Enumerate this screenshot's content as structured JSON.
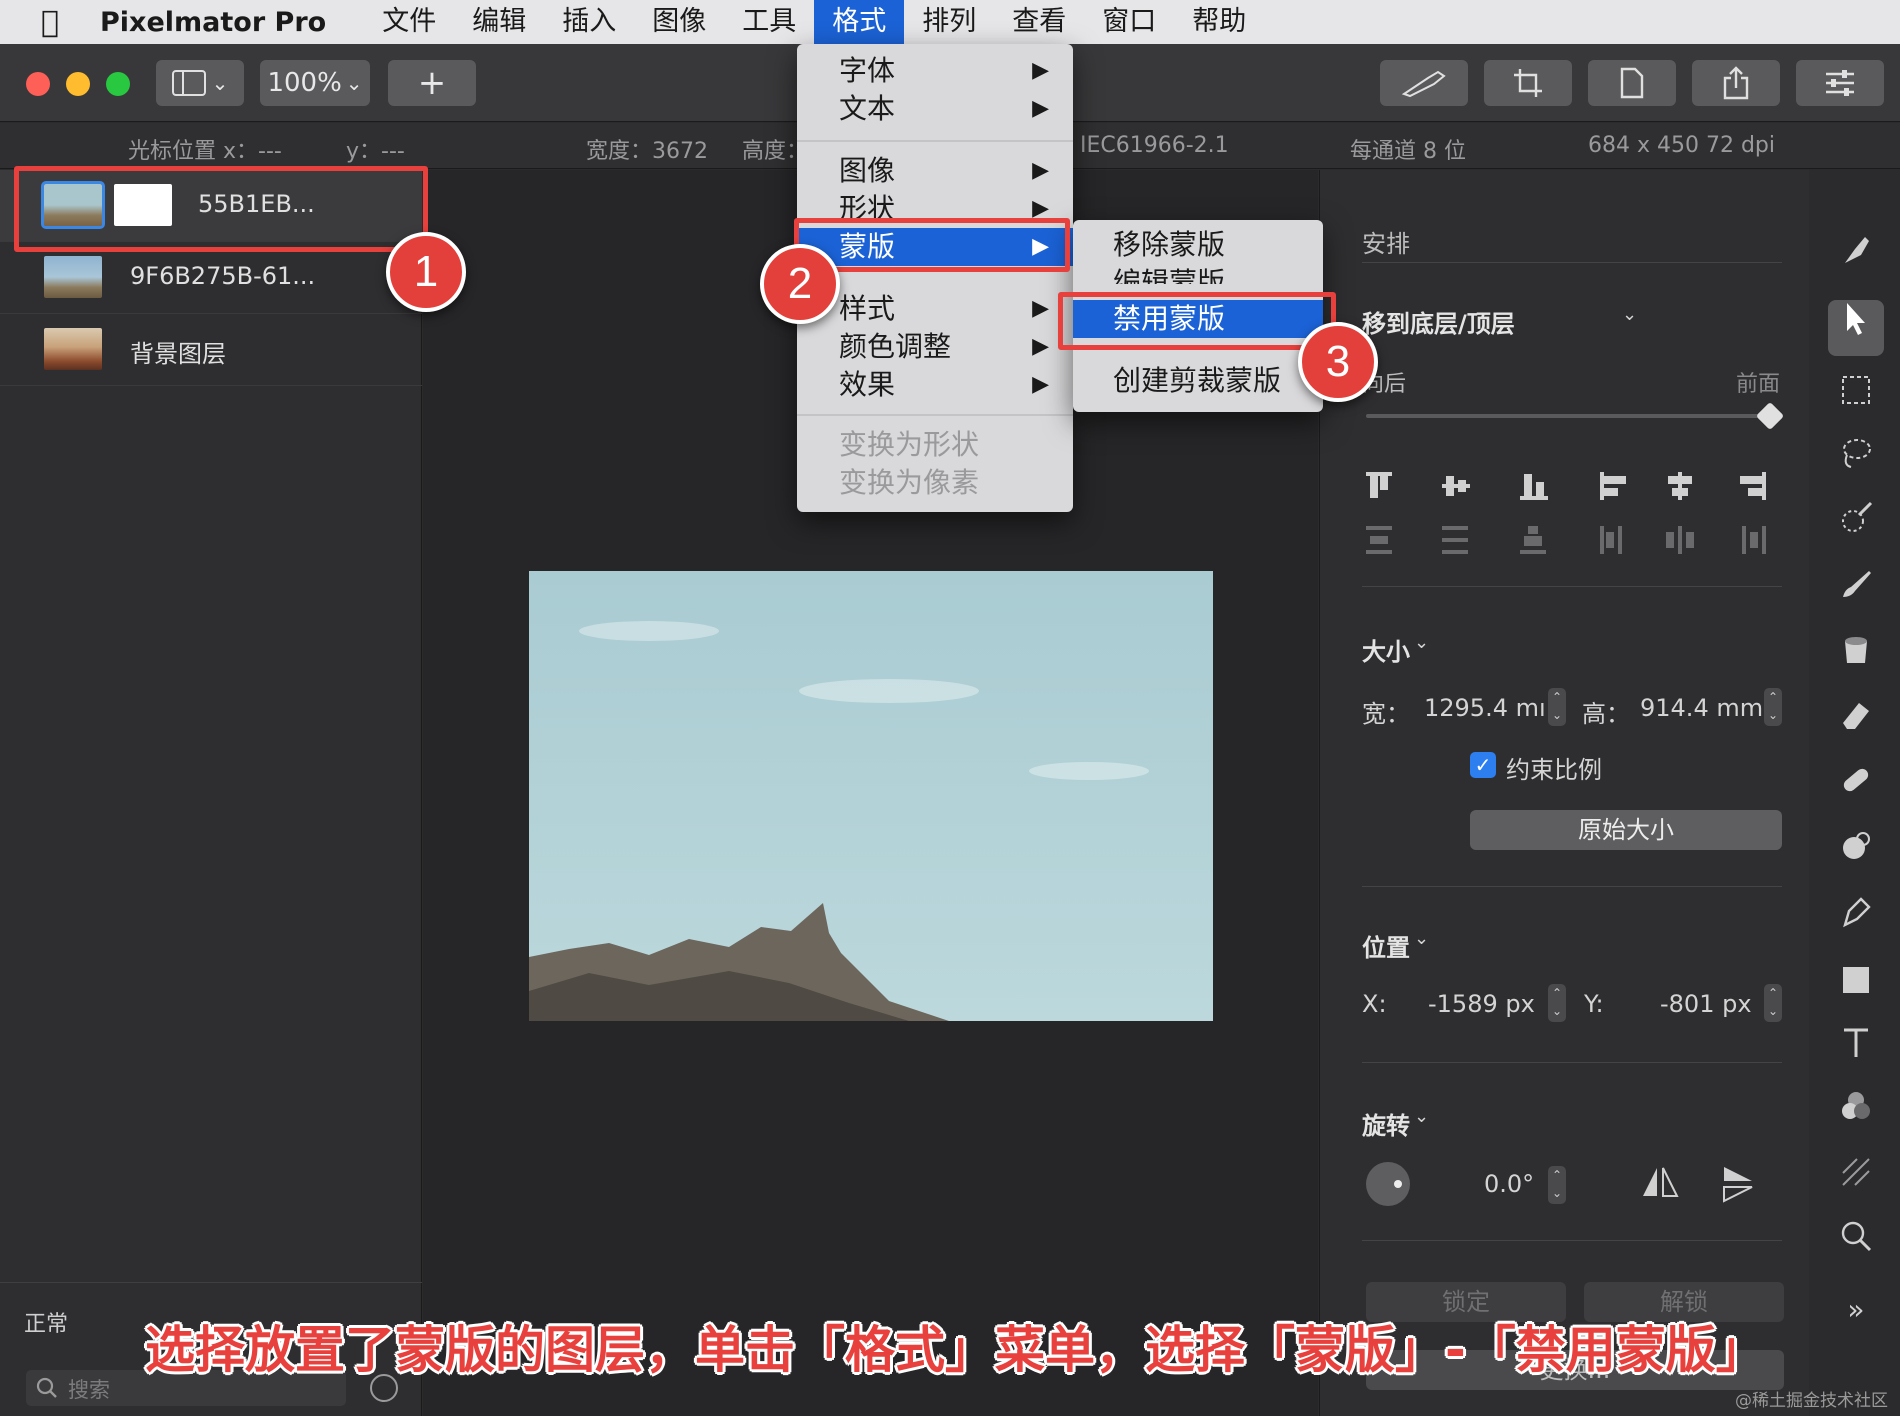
{
  "menubar": {
    "apple_icon": "apple-icon",
    "app_name": "Pixelmator Pro",
    "items": [
      "文件",
      "编辑",
      "插入",
      "图像",
      "工具",
      "格式",
      "排列",
      "查看",
      "窗口",
      "帮助"
    ],
    "active_item": "格式"
  },
  "toolbar": {
    "zoom": "100%",
    "add_label": "+",
    "chevron": "⌄"
  },
  "infobar": {
    "cursor_label": "光标位置 x：---",
    "cursor_y": "y：---",
    "width_label": "宽度：3672",
    "height_label": "高度：",
    "color_profile": "IEC61966-2.1",
    "bits": "每通道 8 位",
    "image_info": "684 x 450 72 dpi"
  },
  "layers": {
    "items": [
      {
        "name": "55B1EB..."
      },
      {
        "name": "9F6B275B-61..."
      },
      {
        "name": "背景图层"
      }
    ],
    "blend_mode": "正常",
    "search_placeholder": "搜索"
  },
  "format_menu": {
    "items": [
      {
        "label": "字体",
        "arrow": "▶"
      },
      {
        "label": "文本",
        "arrow": "▶"
      },
      {
        "label": "图像",
        "arrow": "▶"
      },
      {
        "label": "形状",
        "arrow": "▶"
      },
      {
        "label": "蒙版",
        "arrow": "▶"
      },
      {
        "label": "样式",
        "arrow": "▶"
      },
      {
        "label": "颜色调整",
        "arrow": "▶"
      },
      {
        "label": "效果",
        "arrow": "▶"
      },
      {
        "label": "变换为形状"
      },
      {
        "label": "变换为像素"
      }
    ]
  },
  "mask_submenu": {
    "items": [
      "移除蒙版",
      "编辑蒙版",
      "禁用蒙版",
      "创建剪裁蒙版"
    ]
  },
  "inspector": {
    "arrange_title": "安排",
    "move_to_label": "移到底层/顶层",
    "back_label": "向后",
    "front_label": "前面",
    "size_title": "大小",
    "width_label": "宽：",
    "width_value": "1295.4 mı",
    "height_label": "高：",
    "height_value": "914.4 mm",
    "constrain_label": "约束比例",
    "constrain_checked": true,
    "original_size": "原始大小",
    "position_title": "位置",
    "x_label": "X:",
    "x_value": "-1589 px",
    "y_label": "Y:",
    "y_value": "-801 px",
    "rotate_title": "旋转",
    "rotate_value": "0.0°",
    "lock_label": "锁定",
    "unlock_label": "解锁",
    "replace_label": "更换..."
  },
  "annotations": {
    "badges": [
      "1",
      "2",
      "3"
    ],
    "caption": "选择放置了蒙版的图层，单击「格式」菜单，选择「蒙版」-「禁用蒙版」",
    "accent_color": "#e8403c"
  },
  "watermark": "@稀土掘金技术社区"
}
